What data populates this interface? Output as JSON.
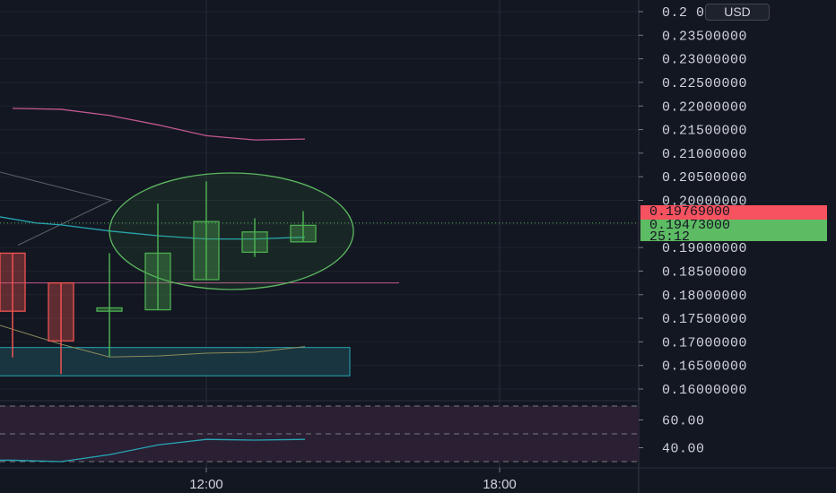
{
  "price_axis": {
    "currency": "USD",
    "labels": [
      "0.24000000",
      "0.23500000",
      "0.23000000",
      "0.22500000",
      "0.22000000",
      "0.21500000",
      "0.21000000",
      "0.20500000",
      "0.20000000",
      "0.19000000",
      "0.18500000",
      "0.18000000",
      "0.17500000",
      "0.17000000",
      "0.16500000",
      "0.16000000"
    ],
    "top_label_visible": "0.2"
  },
  "price_badges": {
    "high_value": "0.19769000",
    "current_value": "0.19473000",
    "countdown": "25:12",
    "high_color": "#f7525f",
    "current_color": "#5dbb63"
  },
  "oscillator_axis": {
    "labels": [
      "60.00",
      "40.00"
    ]
  },
  "time_axis": {
    "labels": [
      "12:00",
      "18:00"
    ]
  },
  "colors": {
    "background": "#131722",
    "up_candle": "#4caf50",
    "down_candle": "#ef5350",
    "ma_pink": "#c2588f",
    "ma_cyan": "#26a6b5",
    "ellipse": "#5cb860",
    "box_fill": "#19353f",
    "box_border": "#26a6b5",
    "osc_line": "#26a6b5",
    "osc_band": "#2a1f33"
  },
  "chart_data": {
    "type": "candlestick",
    "y_unit": "USD",
    "ylim": [
      0.157,
      0.241
    ],
    "candles": [
      {
        "open": 0.1888,
        "high": 0.1888,
        "low": 0.1667,
        "close": 0.1765,
        "direction": "down"
      },
      {
        "open": 0.1825,
        "high": 0.1825,
        "low": 0.1632,
        "close": 0.1702,
        "direction": "down"
      },
      {
        "open": 0.1765,
        "high": 0.1888,
        "low": 0.1668,
        "close": 0.1772,
        "direction": "up"
      },
      {
        "open": 0.1768,
        "high": 0.1993,
        "low": 0.1768,
        "close": 0.1888,
        "direction": "up"
      },
      {
        "open": 0.1832,
        "high": 0.204,
        "low": 0.1832,
        "close": 0.1955,
        "direction": "up"
      },
      {
        "open": 0.189,
        "high": 0.1962,
        "low": 0.188,
        "close": 0.1933,
        "direction": "up"
      },
      {
        "open": 0.1912,
        "high": 0.1977,
        "low": 0.1912,
        "close": 0.1947,
        "direction": "up"
      }
    ],
    "pink_ma": [
      0.2195,
      0.2193,
      0.218,
      0.216,
      0.2137,
      0.2128,
      0.213
    ],
    "cyan_ma": [
      0.1952,
      0.1948,
      0.1935,
      0.1925,
      0.1918,
      0.1918,
      0.1922
    ],
    "support_level": 0.1825,
    "oscillator": {
      "levels": [
        70,
        50,
        30
      ],
      "values": [
        31,
        30,
        35,
        42,
        46,
        45.5,
        46
      ]
    }
  }
}
